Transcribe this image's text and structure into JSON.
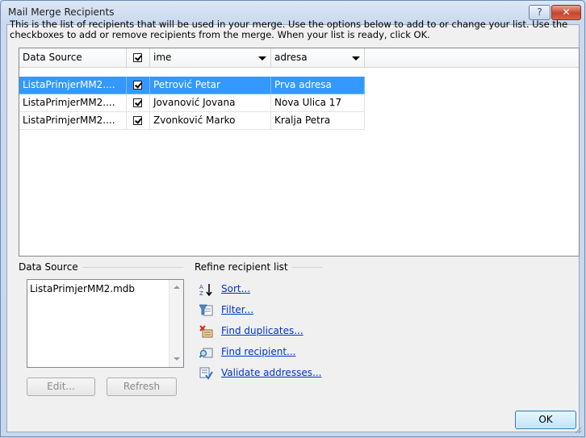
{
  "window": {
    "title": "Mail Merge Recipients",
    "help_label": "?",
    "close_label": "✕"
  },
  "intro_text": "This is the list of recipients that will be used in your merge.  Use the options below to add to or change your list.  Use the checkboxes to add or remove recipients from the merge.  When your list is ready, click OK.",
  "grid": {
    "columns": [
      "Data Source",
      "",
      "ime",
      "adresa"
    ],
    "rows": [
      {
        "source": "ListaPrimjerMM2....",
        "checked": true,
        "ime": "Petrović Petar",
        "adresa": "Prva adresa",
        "selected": true
      },
      {
        "source": "ListaPrimjerMM2....",
        "checked": true,
        "ime": "Jovanović Jovana",
        "adresa": "Nova Ulica 17",
        "selected": false
      },
      {
        "source": "ListaPrimjerMM2....",
        "checked": true,
        "ime": "Zvonković Marko",
        "adresa": "Kralja Petra",
        "selected": false
      }
    ]
  },
  "data_source": {
    "label": "Data Source",
    "items": [
      "ListaPrimjerMM2.mdb"
    ],
    "edit_label": "Edit...",
    "refresh_label": "Refresh"
  },
  "refine": {
    "label": "Refine recipient list",
    "links": [
      "Sort...",
      "Filter...",
      "Find duplicates...",
      "Find recipient...",
      "Validate addresses..."
    ]
  },
  "ok_label": "OK",
  "colors": {
    "selection": "#3399ff",
    "link": "#0033cc",
    "close": "#c6462f"
  }
}
